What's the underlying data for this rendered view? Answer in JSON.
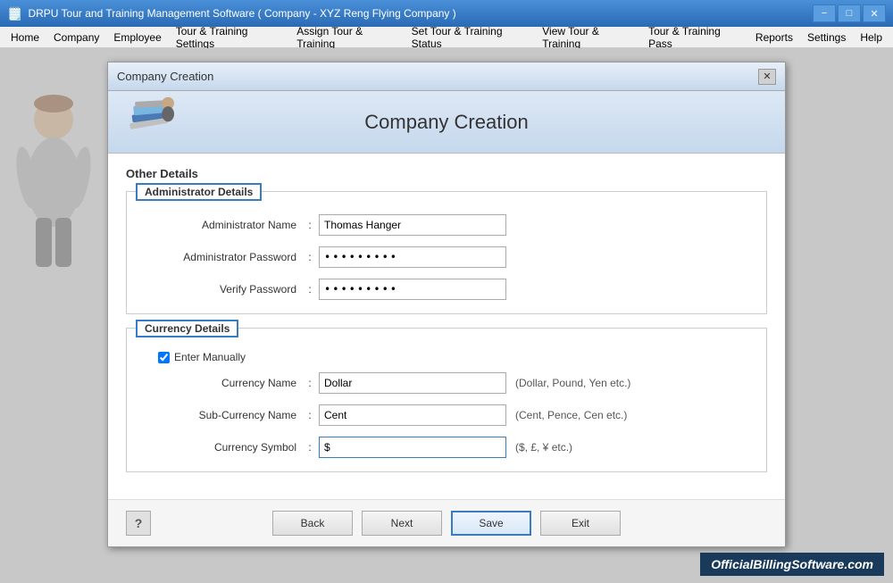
{
  "app": {
    "title": "DRPU Tour and Training Management Software ( Company - XYZ Reng Flying Company )",
    "icon": "app-icon"
  },
  "titlebar": {
    "minimize": "−",
    "maximize": "□",
    "close": "✕"
  },
  "menubar": {
    "items": [
      "Home",
      "Company",
      "Employee",
      "Tour & Training Settings",
      "Assign Tour & Training",
      "Set Tour & Training Status",
      "View Tour & Training",
      "Tour & Training Pass",
      "Reports",
      "Settings",
      "Help"
    ]
  },
  "dialog": {
    "title": "Company Creation",
    "header_title": "Company Creation",
    "close_btn": "✕",
    "sections": {
      "other_details_label": "Other Details",
      "admin": {
        "section_title": "Administrator Details",
        "fields": [
          {
            "label": "Administrator Name",
            "value": "Thomas Hanger",
            "type": "text",
            "name": "admin-name-input"
          },
          {
            "label": "Administrator Password",
            "value": "•••••••••",
            "type": "password",
            "name": "admin-password-input"
          },
          {
            "label": "Verify Password",
            "value": "•••••••••",
            "type": "password",
            "name": "verify-password-input"
          }
        ]
      },
      "currency": {
        "section_title": "Currency Details",
        "enter_manually_label": "Enter Manually",
        "enter_manually_checked": true,
        "fields": [
          {
            "label": "Currency Name",
            "value": "Dollar",
            "type": "text",
            "hint": "(Dollar, Pound, Yen etc.)",
            "name": "currency-name-input"
          },
          {
            "label": "Sub-Currency Name",
            "value": "Cent",
            "type": "text",
            "hint": "(Cent, Pence, Cen etc.)",
            "name": "sub-currency-name-input"
          },
          {
            "label": "Currency Symbol",
            "value": "$",
            "type": "text",
            "hint": "($, £, ¥ etc.)",
            "name": "currency-symbol-input"
          }
        ]
      }
    },
    "footer": {
      "help_btn": "?",
      "buttons": [
        "Back",
        "Next",
        "Save",
        "Exit"
      ]
    }
  },
  "branding": "OfficialBillingSoftware.com"
}
